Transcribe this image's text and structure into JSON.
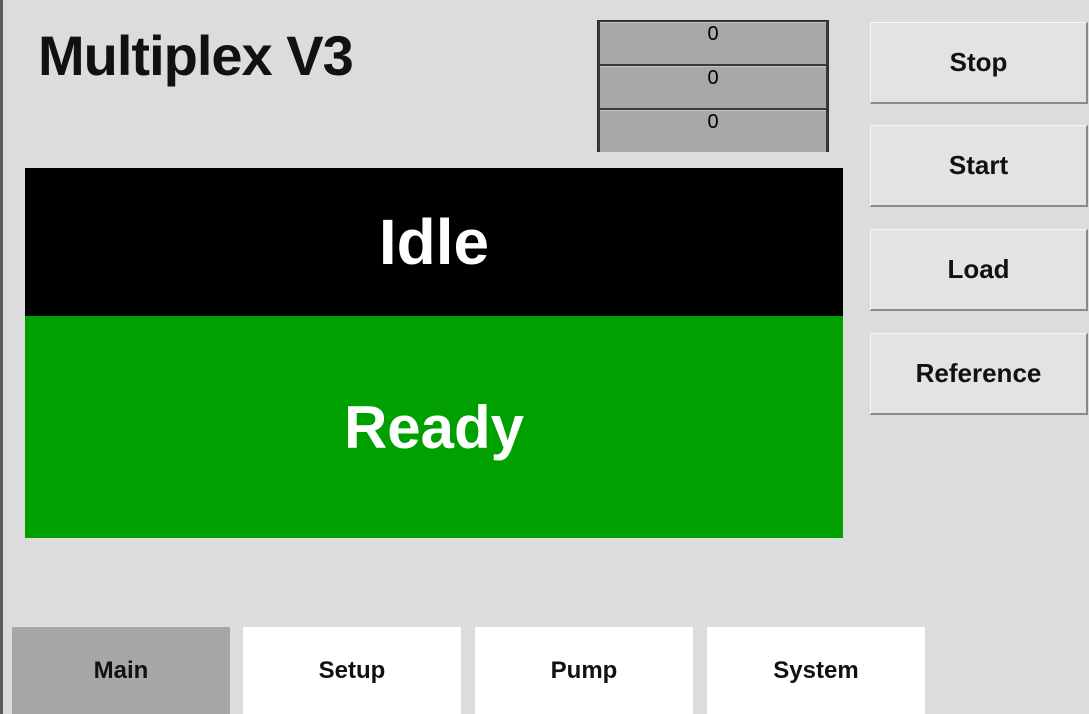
{
  "header": {
    "title": "Multiplex V3"
  },
  "counters": [
    "0",
    "0",
    "0"
  ],
  "status": {
    "state": "Idle",
    "readiness": "Ready",
    "state_bg": "#000000",
    "readiness_bg": "#00a000"
  },
  "controls": {
    "stop_label": "Stop",
    "start_label": "Start",
    "load_label": "Load",
    "reference_label": "Reference"
  },
  "tabs": [
    {
      "label": "Main",
      "active": true
    },
    {
      "label": "Setup",
      "active": false
    },
    {
      "label": "Pump",
      "active": false
    },
    {
      "label": "System",
      "active": false
    }
  ]
}
